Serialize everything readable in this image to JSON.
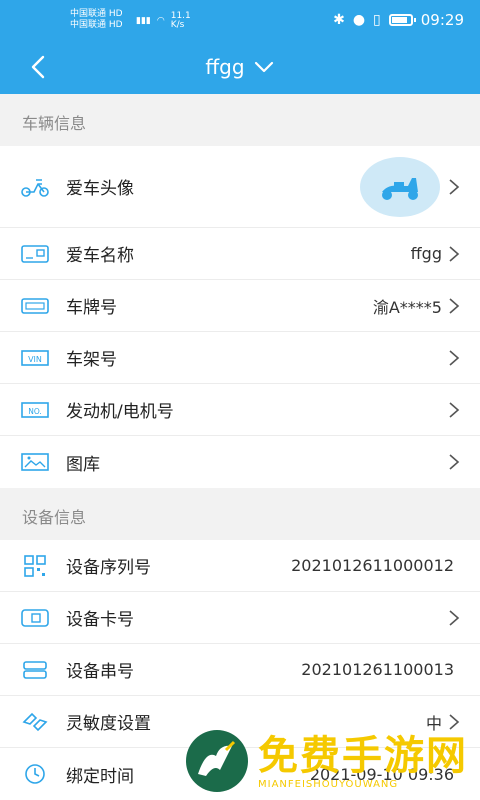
{
  "status_bar": {
    "carrier1": "中国联通 HD",
    "carrier2": "中国联通 HD",
    "speed": "11.1",
    "speed_unit": "K/s",
    "time": "09:29"
  },
  "header": {
    "title": "ffgg",
    "accent": "#2fa6e9"
  },
  "vehicle_section": {
    "title": "车辆信息",
    "items": [
      {
        "label": "爱车头像",
        "value": "",
        "icon": "scooter-icon"
      },
      {
        "label": "爱车名称",
        "value": "ffgg",
        "icon": "id-card-icon"
      },
      {
        "label": "车牌号",
        "value": "渝A****5",
        "icon": "license-plate-icon"
      },
      {
        "label": "车架号",
        "value": "",
        "icon": "vin-icon"
      },
      {
        "label": "发动机/电机号",
        "value": "",
        "icon": "engine-number-icon"
      },
      {
        "label": "图库",
        "value": "",
        "icon": "gallery-icon"
      }
    ]
  },
  "device_section": {
    "title": "设备信息",
    "items": [
      {
        "label": "设备序列号",
        "value": "2021012611000012",
        "icon": "qr-code-icon"
      },
      {
        "label": "设备卡号",
        "value": "",
        "icon": "sim-card-icon"
      },
      {
        "label": "设备串号",
        "value": "202101261100013",
        "icon": "serial-icon"
      },
      {
        "label": "灵敏度设置",
        "value": "中",
        "icon": "sensitivity-icon"
      },
      {
        "label": "绑定时间",
        "value": "2021-09-10 09:36",
        "icon": "clock-icon"
      }
    ]
  },
  "watermark": {
    "text": "免费手游网",
    "sub": "MIANFEISHOUYOUWANG"
  }
}
